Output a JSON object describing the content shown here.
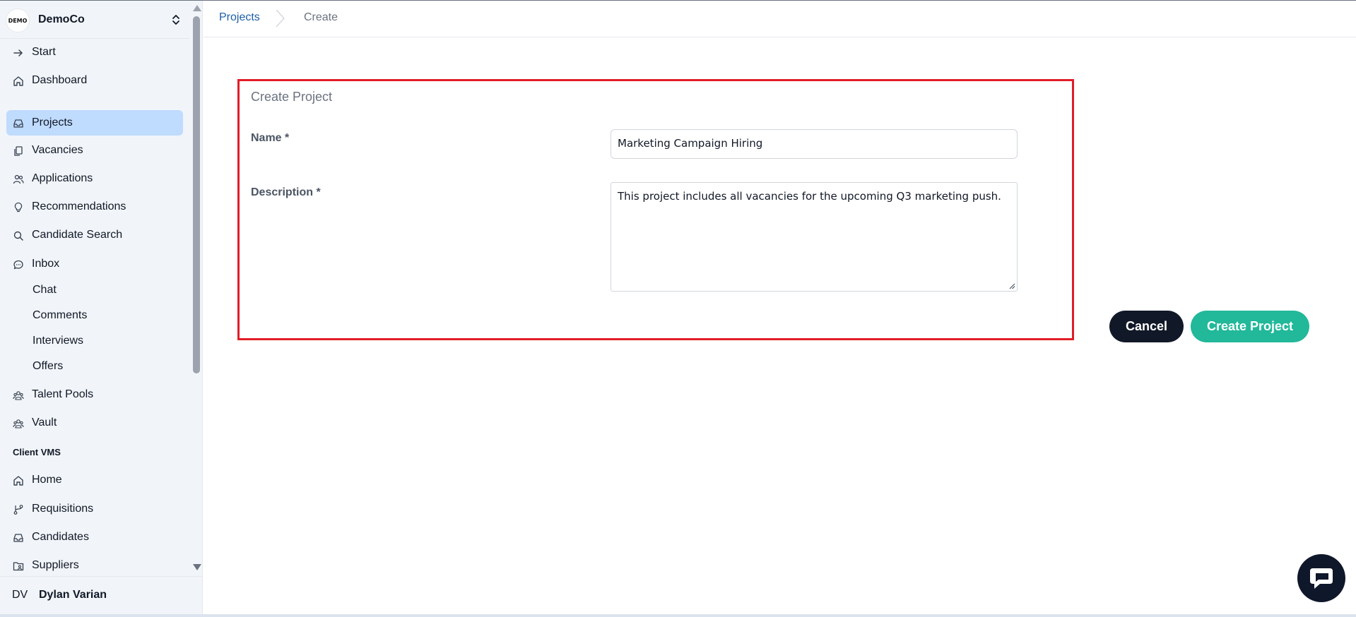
{
  "brand": {
    "name": "DemoCo",
    "logo_text": "DEMO"
  },
  "sidebar": {
    "items": [
      {
        "label": "Start",
        "icon": "arrow-right-icon"
      },
      {
        "label": "Dashboard",
        "icon": "home-icon"
      },
      {
        "label": "Projects",
        "icon": "inbox-icon",
        "active": true
      },
      {
        "label": "Vacancies",
        "icon": "copy-icon"
      },
      {
        "label": "Applications",
        "icon": "users-icon"
      },
      {
        "label": "Recommendations",
        "icon": "lightbulb-icon"
      },
      {
        "label": "Candidate Search",
        "icon": "search-icon"
      },
      {
        "label": "Inbox",
        "icon": "chat-icon"
      }
    ],
    "inbox_sub": [
      "Chat",
      "Comments",
      "Interviews",
      "Offers"
    ],
    "items2": [
      {
        "label": "Talent Pools",
        "icon": "group-icon"
      },
      {
        "label": "Vault",
        "icon": "group-icon"
      }
    ],
    "section": "Client VMS",
    "items3": [
      {
        "label": "Home",
        "icon": "home-icon"
      },
      {
        "label": "Requisitions",
        "icon": "branch-icon"
      },
      {
        "label": "Candidates",
        "icon": "inbox-icon"
      },
      {
        "label": "Suppliers",
        "icon": "folder-user-icon"
      }
    ],
    "user": {
      "initials": "DV",
      "name": "Dylan Varian"
    }
  },
  "breadcrumb": {
    "parent": "Projects",
    "current": "Create"
  },
  "form": {
    "title": "Create Project",
    "name_label": "Name *",
    "name_value": "Marketing Campaign Hiring",
    "description_label": "Description *",
    "description_value": "This project includes all vacancies for the upcoming Q3 marketing push."
  },
  "actions": {
    "cancel": "Cancel",
    "create": "Create Project"
  },
  "colors": {
    "accent": "#22b89a",
    "dark": "#111827",
    "active_nav": "#bfdbfe",
    "highlight": "#e11d27",
    "link": "#1d5fa6"
  }
}
